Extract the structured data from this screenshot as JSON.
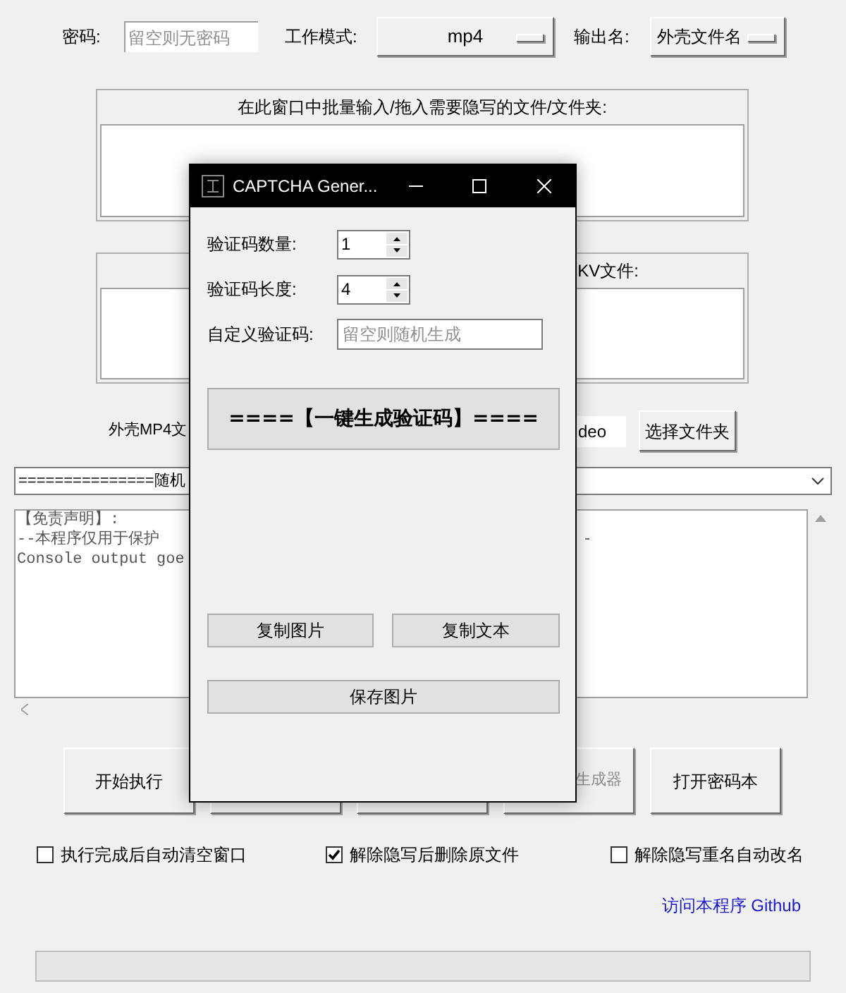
{
  "toolbar": {
    "password_label": "密码:",
    "password_field": {
      "placeholder": "留空则无密码"
    },
    "mode_label": "工作模式:",
    "mode_value": "mp4",
    "output_label": "输出名:",
    "output_value": "外壳文件名"
  },
  "input_panel": {
    "header": "在此窗口中批量输入/拖入需要隐写的文件/文件夹:"
  },
  "shell_panel": {
    "header": "KV文件:"
  },
  "shell_row": {
    "label": "外壳MP4文",
    "path_value": "deo",
    "button": "选择文件夹"
  },
  "combobox": {
    "value": "===============随机"
  },
  "console": {
    "lines": [
      {
        "left": "【免责声明】:"
      },
      {
        "left": "--本程序仅用于保护",
        "right": "-"
      },
      {
        "left": "Console output goe"
      }
    ]
  },
  "actions": [
    {
      "kind": "button",
      "label": "开始执行",
      "disabled": false
    },
    {
      "kind": "covered"
    },
    {
      "kind": "covered"
    },
    {
      "kind": "button",
      "label": "生成器",
      "disabled": true
    },
    {
      "kind": "button",
      "label": "打开密码本",
      "disabled": false
    }
  ],
  "options": [
    {
      "label": "执行完成后自动清空窗口",
      "checked": false
    },
    {
      "label": "解除隐写后删除原文件",
      "checked": true
    },
    {
      "label": "解除隐写重名自动改名",
      "checked": false
    }
  ],
  "link": "访问本程序 Github",
  "progress": {
    "level": 0
  },
  "dialog": {
    "title": "CAPTCHA Gener...",
    "count_label": "验证码数量:",
    "count_value": "1",
    "length_label": "验证码长度:",
    "length_value": "4",
    "custom_label": "自定义验证码:",
    "custom_field": {
      "placeholder": "留空则随机生成"
    },
    "generate_button": "====【一键生成验证码】====",
    "copy_image": "复制图片",
    "copy_text": "复制文本",
    "save_image": "保存图片"
  }
}
